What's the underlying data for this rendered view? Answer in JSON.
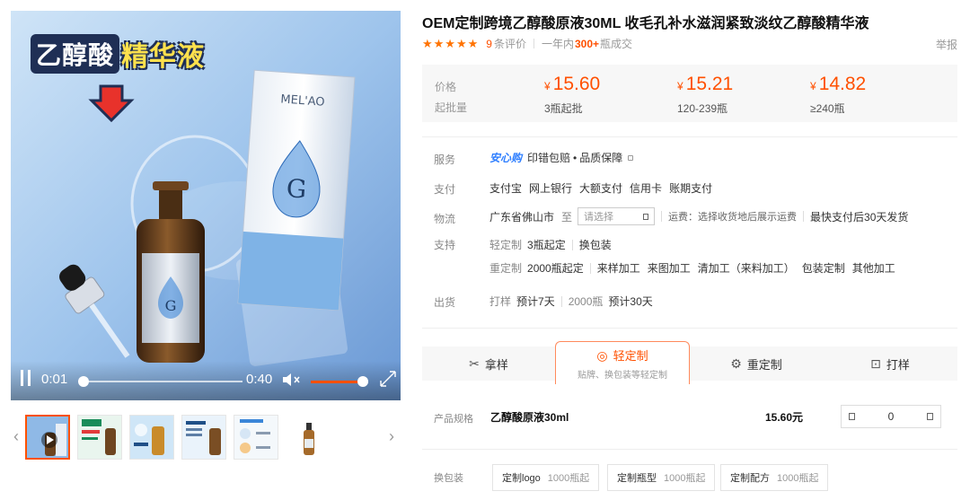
{
  "media": {
    "overlay_title_part1": "乙醇酸",
    "overlay_title_part2": "精华液",
    "video": {
      "current_time": "0:01",
      "duration": "0:40",
      "progress": 0.03,
      "volume": 0.9
    }
  },
  "thumbnails": {
    "prev_glyph": "‹",
    "next_glyph": "›",
    "count": 6,
    "active_index": 0
  },
  "product": {
    "title": "OEM定制跨境乙醇酸原液30ML 收毛孔补水滋润紧致淡纹乙醇酸精华液",
    "rating_stars": "★★★★★",
    "review_count": "9",
    "review_label": "条评价",
    "sales_prefix": "一年内",
    "sales_count": "300+",
    "sales_suffix": "瓶成交",
    "report_label": "举报"
  },
  "pricing": {
    "price_label": "价格",
    "moq_label": "起批量",
    "currency": "¥",
    "tiers": [
      {
        "price": "15.60",
        "qty": "3瓶起批"
      },
      {
        "price": "15.21",
        "qty": "120-239瓶"
      },
      {
        "price": "14.82",
        "qty": "≥240瓶"
      }
    ]
  },
  "service": {
    "label": "服务",
    "brand": "安心购",
    "items": [
      "印错包赔",
      "品质保障"
    ]
  },
  "payment": {
    "label": "支付",
    "methods": [
      "支付宝",
      "网上银行",
      "大额支付",
      "信用卡",
      "账期支付"
    ]
  },
  "logistics": {
    "label": "物流",
    "origin": "广东省佛山市",
    "to": "至",
    "select_placeholder": "请选择",
    "freight_text": "运费：选择收货地后展示运费",
    "delivery_text": "最快支付后30天发货"
  },
  "support": {
    "label": "支持",
    "light_label": "轻定制",
    "light_min": "3瓶起定",
    "light_items": [
      "换包装"
    ],
    "heavy_label": "重定制",
    "heavy_min": "2000瓶起定",
    "heavy_items": [
      "来样加工",
      "来图加工",
      "清加工（来料加工）",
      "包装定制",
      "其他加工"
    ]
  },
  "shipping": {
    "label": "出货",
    "sample_label": "打样",
    "sample_time": "预计7天",
    "bulk_label": "2000瓶",
    "bulk_time": "预计30天"
  },
  "tabs": [
    {
      "label": "拿样",
      "icon": "sample-icon",
      "glyph": "✂"
    },
    {
      "label": "轻定制",
      "sub": "贴牌、换包装等轻定制",
      "icon": "light-custom-icon",
      "glyph": "◎"
    },
    {
      "label": "重定制",
      "icon": "heavy-custom-icon",
      "glyph": "⚙"
    },
    {
      "label": "打样",
      "icon": "proof-icon",
      "glyph": "⊡"
    }
  ],
  "spec": {
    "label": "产品规格",
    "name": "乙醇酸原液30ml",
    "price": "15.60元",
    "quantity": "0"
  },
  "packaging": {
    "label": "换包装",
    "options": [
      {
        "name": "定制logo",
        "min": "1000瓶起"
      },
      {
        "name": "定制瓶型",
        "min": "1000瓶起"
      },
      {
        "name": "定制配方",
        "min": "1000瓶起"
      }
    ]
  },
  "colors": {
    "accent": "#ff5000",
    "star": "#ff7300",
    "brand_blue": "#2f7fff"
  }
}
